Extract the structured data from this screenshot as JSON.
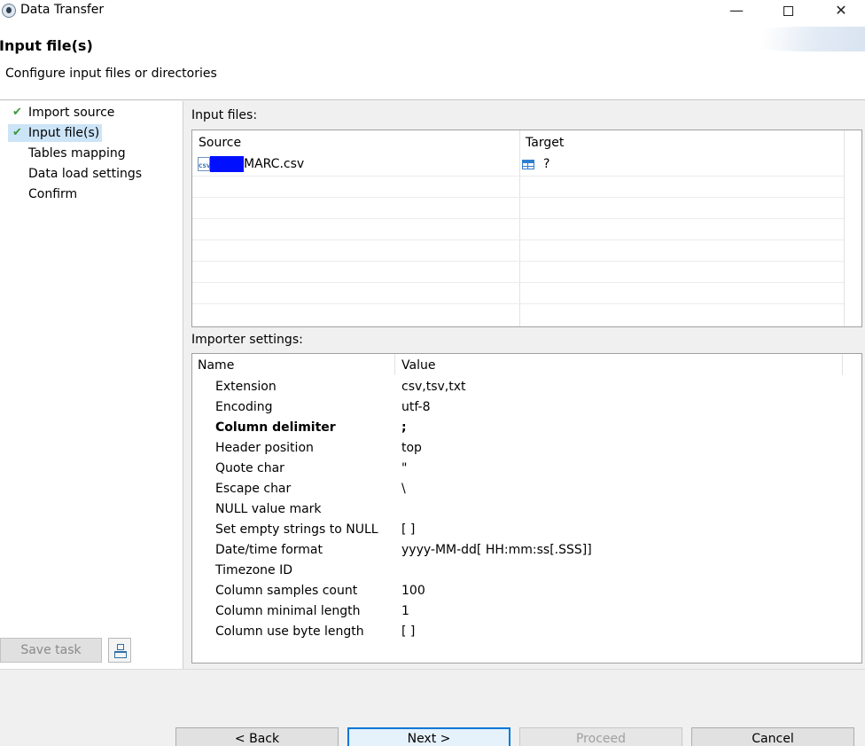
{
  "window": {
    "title": "Data Transfer"
  },
  "header": {
    "title": "Input file(s)",
    "subtitle": "Configure input files or directories"
  },
  "sidebar": {
    "steps": [
      {
        "label": "Import source",
        "done": true
      },
      {
        "label": "Input file(s)",
        "done": true,
        "active": true
      },
      {
        "label": "Tables mapping",
        "done": false
      },
      {
        "label": "Data load settings",
        "done": false
      },
      {
        "label": "Confirm",
        "done": false
      }
    ],
    "save_task_label": "Save task",
    "check_icon": "check-icon",
    "task_icon": "tasks-icon"
  },
  "input_files": {
    "label": "Input files:",
    "columns": [
      "Source",
      "Target"
    ],
    "rows": [
      {
        "source_icon": "csv-file-icon",
        "source": "MARC.csv",
        "target_icon": "table-icon",
        "target": "?"
      }
    ]
  },
  "importer_settings": {
    "label": "Importer settings:",
    "columns": [
      "Name",
      "Value"
    ],
    "properties": [
      {
        "name": "Extension",
        "value": "csv,tsv,txt"
      },
      {
        "name": "Encoding",
        "value": "utf-8"
      },
      {
        "name": "Column delimiter",
        "value": ";",
        "bold": true
      },
      {
        "name": "Header position",
        "value": "top"
      },
      {
        "name": "Quote char",
        "value": "\""
      },
      {
        "name": "Escape char",
        "value": "\\"
      },
      {
        "name": "NULL value mark",
        "value": ""
      },
      {
        "name": "Set empty strings to NULL",
        "value": "[  ]"
      },
      {
        "name": "Date/time format",
        "value": "yyyy-MM-dd[ HH:mm:ss[.SSS]]"
      },
      {
        "name": "Timezone ID",
        "value": ""
      },
      {
        "name": "Column samples count",
        "value": "100"
      },
      {
        "name": "Column minimal length",
        "value": "1"
      },
      {
        "name": "Column use byte length",
        "value": "[  ]"
      }
    ]
  },
  "footer": {
    "back_label": "< Back",
    "next_label": "Next >",
    "proceed_label": "Proceed",
    "cancel_label": "Cancel"
  },
  "colors": {
    "accent": "#0078d7",
    "selection": "#cce4f7",
    "check": "#3a9a3a",
    "redaction": "#0010ff"
  }
}
